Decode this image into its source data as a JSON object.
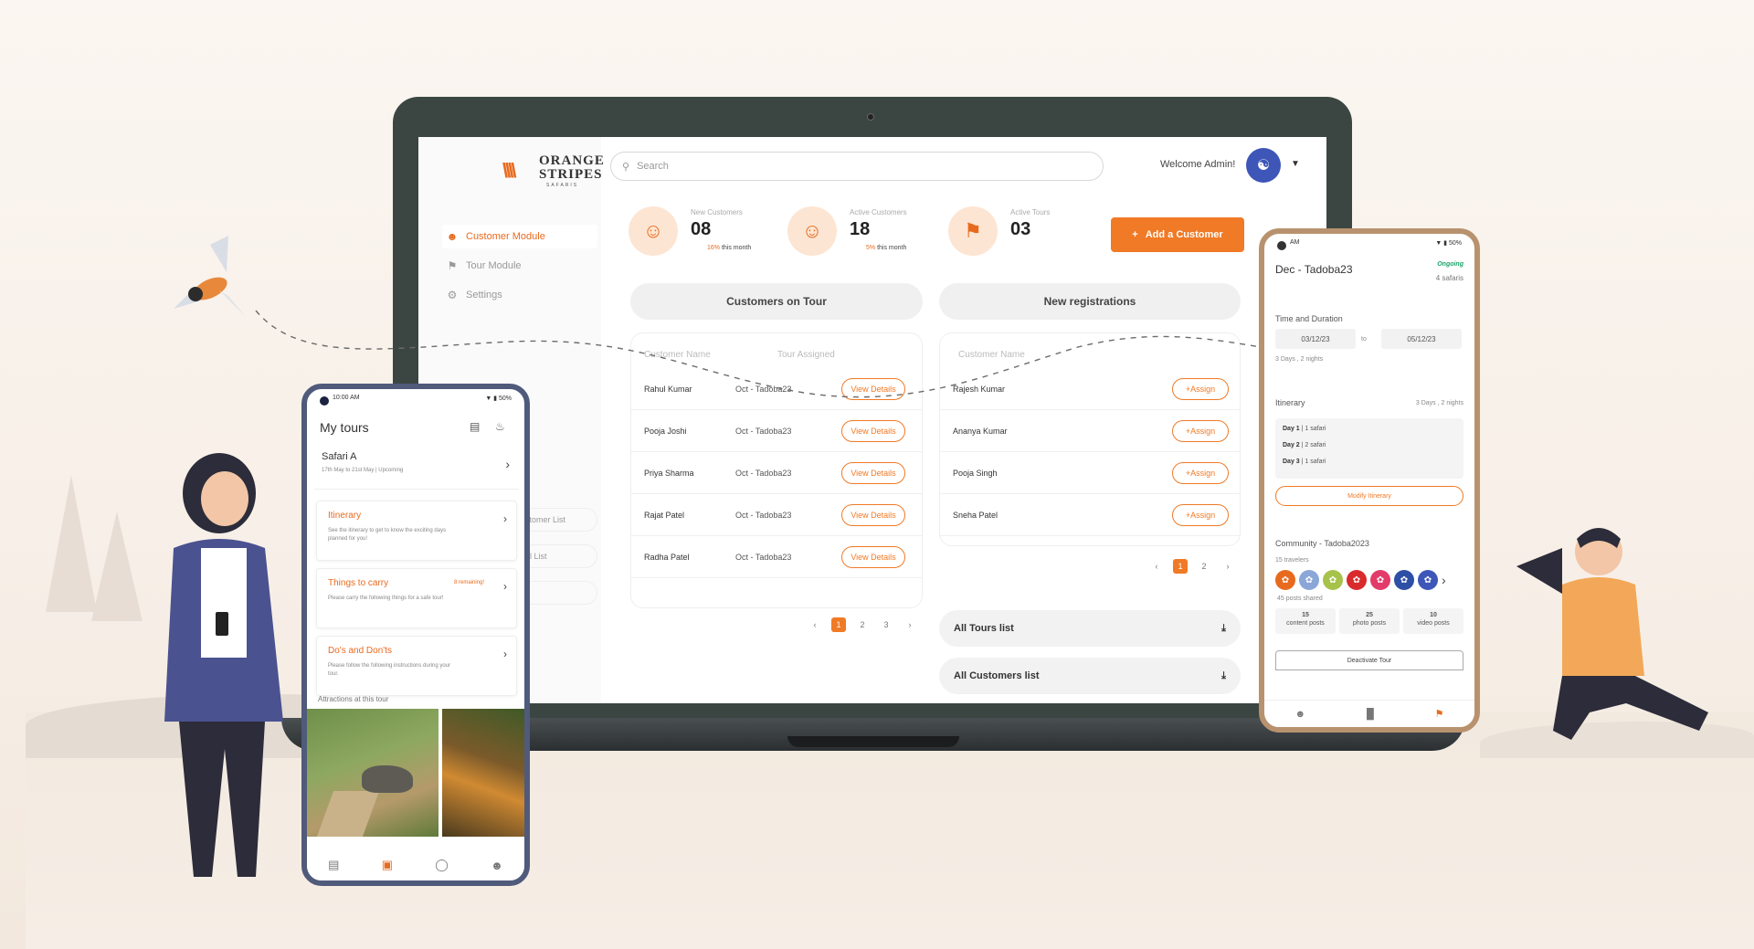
{
  "brand": {
    "line1": "ORANGE",
    "line2": "STRIPES",
    "line3": "SAFARIS"
  },
  "sidebar": {
    "items": [
      {
        "label": "Customer Module",
        "icon": "users-icon",
        "active": true
      },
      {
        "label": "Tour Module",
        "icon": "flag-icon",
        "active": false
      },
      {
        "label": "Settings",
        "icon": "gear-icon",
        "active": false
      }
    ],
    "partial_items": [
      "stomer List",
      "ol List"
    ]
  },
  "search": {
    "placeholder": "Search"
  },
  "header": {
    "welcome": "Welcome Admin!"
  },
  "stats": [
    {
      "label": "New Customers",
      "value": "08",
      "change": "16%",
      "change_text": "this month"
    },
    {
      "label": "Active Customers",
      "value": "18",
      "change": "5%",
      "change_text": "this month"
    },
    {
      "label": "Active Tours",
      "value": "03"
    }
  ],
  "add_customer_label": "Add a Customer",
  "customers_on_tour": {
    "title": "Customers on Tour",
    "columns": [
      "Customer Name",
      "Tour Assigned"
    ],
    "action_label": "View Details",
    "rows": [
      {
        "name": "Rahul Kumar",
        "tour": "Oct - Tadoba23"
      },
      {
        "name": "Pooja Joshi",
        "tour": "Oct - Tadoba23"
      },
      {
        "name": "Priya Sharma",
        "tour": "Oct - Tadoba23"
      },
      {
        "name": "Rajat Patel",
        "tour": "Oct - Tadoba23"
      },
      {
        "name": "Radha Patel",
        "tour": "Oct - Tadoba23"
      }
    ],
    "pages": [
      "1",
      "2",
      "3"
    ],
    "current_page": "1"
  },
  "new_registrations": {
    "title": "New registrations",
    "columns": [
      "Customer Name"
    ],
    "action_label": "Assign",
    "rows": [
      {
        "name": "Rajesh Kumar"
      },
      {
        "name": "Ananya Kumar"
      },
      {
        "name": "Pooja Singh"
      },
      {
        "name": "Sneha Patel"
      }
    ],
    "pages": [
      "1",
      "2"
    ],
    "current_page": "1"
  },
  "lists": [
    {
      "label": "All Tours list"
    },
    {
      "label": "All Customers list"
    }
  ],
  "left_phone": {
    "time": "10:00 AM",
    "battery": "50%",
    "title": "My tours",
    "tour": {
      "name": "Safari A",
      "detail": "17th May to 21st May | Upcoming"
    },
    "cards": [
      {
        "title": "Itinerary",
        "subtitle": "See the itinerary to get to know the exciting days planned for you!"
      },
      {
        "title": "Things to carry",
        "tag": "8 remaining!",
        "subtitle": "Please carry the following things for a safe tour!"
      },
      {
        "title": "Do's and Don'ts",
        "subtitle": "Please follow the following instructions during your tour."
      }
    ],
    "attractions_label": "Attractions at this tour"
  },
  "right_phone": {
    "time": "AM",
    "battery": "50%",
    "title": "Dec - Tadoba23",
    "status": "Ongoing",
    "safaris": "4 safaris",
    "time_duration_label": "Time and Duration",
    "from": "03/12/23",
    "to_word": "to",
    "to": "05/12/23",
    "duration": "3 Days , 2 nights",
    "itinerary_label": "Itinerary",
    "itinerary_duration": "3 Days , 2 nights",
    "days": [
      {
        "day": "Day 1",
        "detail": "| 1 safari"
      },
      {
        "day": "Day 2",
        "detail": "| 2 safari"
      },
      {
        "day": "Day 3",
        "detail": "| 1 safari"
      }
    ],
    "modify_label": "Modify Itinerary",
    "community_label": "Community - Tadoba2023",
    "travelers": "15 travelers",
    "posts_shared": "45 posts shared",
    "post_stats": [
      {
        "value": "15",
        "label": "content posts"
      },
      {
        "value": "25",
        "label": "photo posts"
      },
      {
        "value": "10",
        "label": "video posts"
      }
    ],
    "deactivate_label": "Deactivate Tour"
  },
  "colors": {
    "accent": "#f07a26",
    "status_green": "#1aa36a",
    "phone_frame_left": "#505a7a",
    "phone_frame_right": "#b8926e"
  }
}
